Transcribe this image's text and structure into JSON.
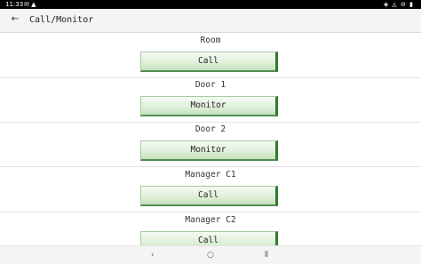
{
  "status_bar": {
    "time": "11:33",
    "left_icons": "✉ ▲",
    "right_icons": "◈ ◬ ⊖ ▮"
  },
  "app_bar": {
    "back_icon": "←",
    "title": "Call/Monitor"
  },
  "rows": [
    {
      "label": "Room",
      "button": "Call"
    },
    {
      "label": "Door 1",
      "button": "Monitor"
    },
    {
      "label": "Door 2",
      "button": "Monitor"
    },
    {
      "label": "Manager C1",
      "button": "Call"
    },
    {
      "label": "Manager C2",
      "button": "Call"
    }
  ],
  "nav_bar": {
    "back": "‹",
    "home": "○",
    "recents": "⦀"
  },
  "colors": {
    "button_accent": "#2e7b2e",
    "button_fill": "#e0f0da"
  }
}
